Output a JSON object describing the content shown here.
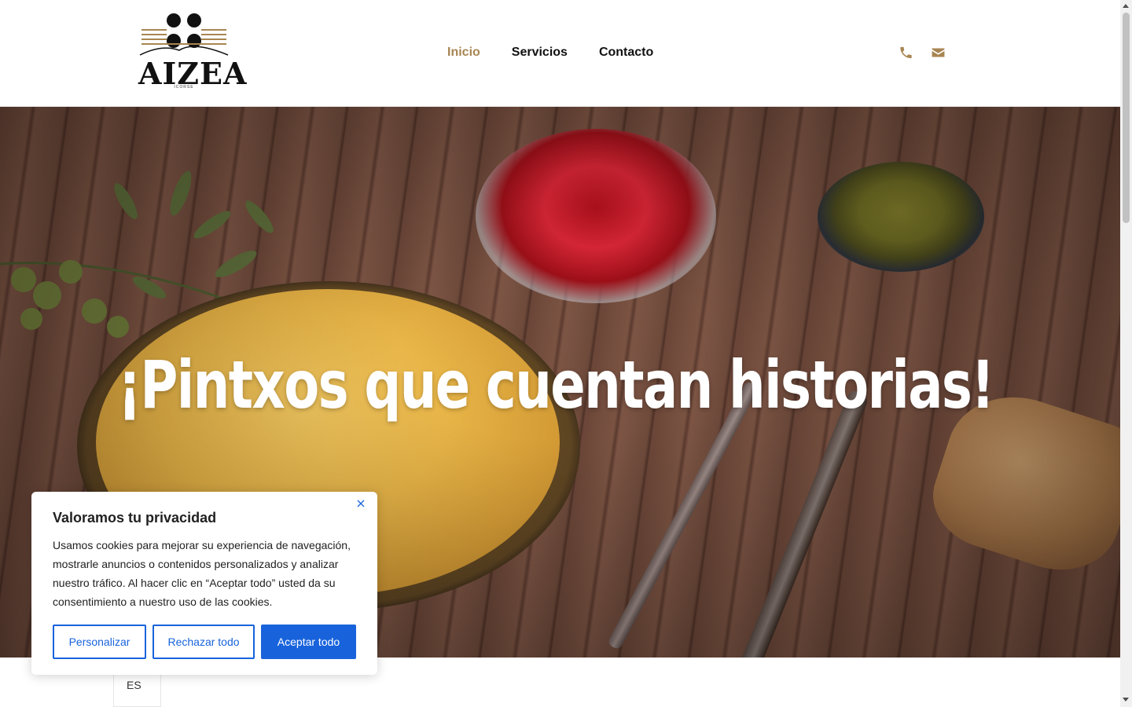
{
  "brand": {
    "name": "AIZEA",
    "sub": "ICORSE"
  },
  "nav": {
    "items": [
      {
        "label": "Inicio",
        "active": true
      },
      {
        "label": "Servicios",
        "active": false
      },
      {
        "label": "Contacto",
        "active": false
      }
    ]
  },
  "header_icons": [
    "phone-icon",
    "envelope-icon"
  ],
  "hero": {
    "title": "¡Pintxos que cuentan historias!"
  },
  "cookie": {
    "title": "Valoramos tu privacidad",
    "text": "Usamos cookies para mejorar su experiencia de navegación, mostrarle anuncios o contenidos personalizados y analizar nuestro tráfico. Al hacer clic en “Aceptar todo” usted da su consentimiento a nuestro uso de las cookies.",
    "customize_label": "Personalizar",
    "reject_label": "Rechazar todo",
    "accept_label": "Aceptar todo"
  },
  "language": {
    "current": "ES"
  },
  "colors": {
    "accent": "#a88552",
    "cookie_blue": "#1863dc"
  }
}
